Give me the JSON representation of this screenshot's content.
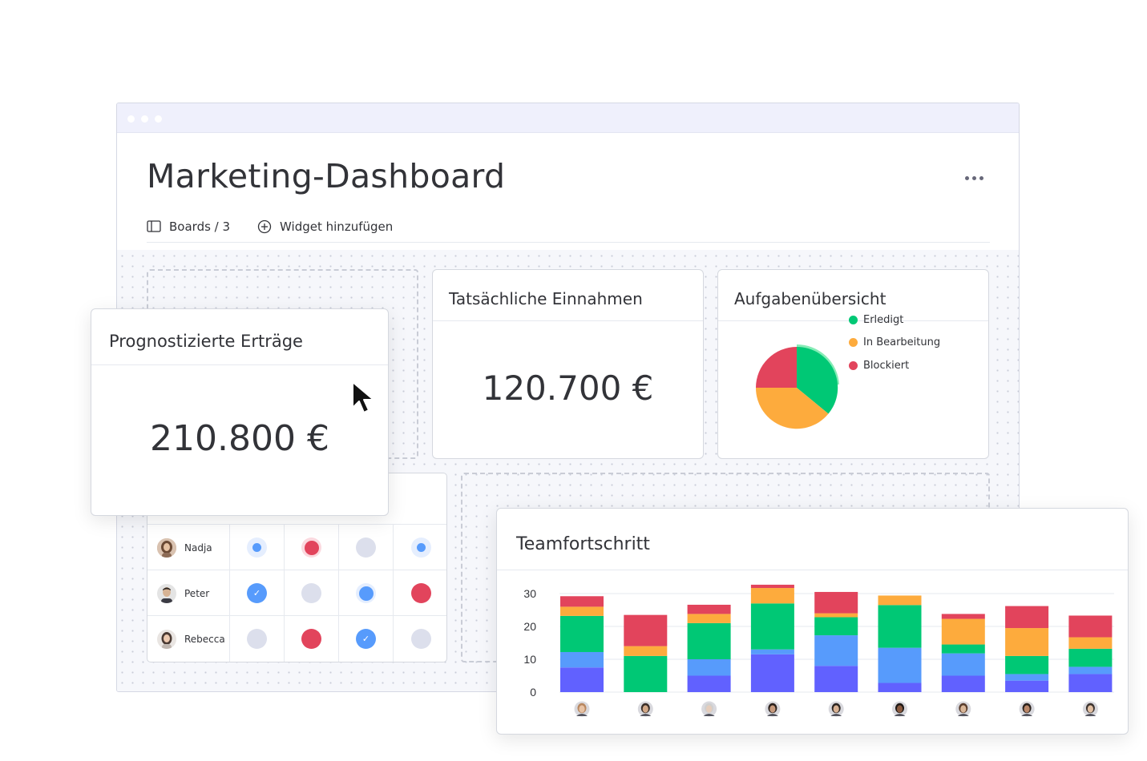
{
  "header": {
    "title": "Marketing-Dashboard",
    "boards_label": "Boards / 3",
    "add_widget_label": "Widget hinzufügen"
  },
  "widgets": {
    "forecast": {
      "title": "Prognostizierte Erträge",
      "value": "210.800 €"
    },
    "actual": {
      "title": "Tatsächliche Einnahmen",
      "value": "120.700 €"
    },
    "tasks": {
      "title": "Aufgabenübersicht",
      "legend": [
        {
          "label": "Erledigt",
          "color": "#00c875"
        },
        {
          "label": "In Bearbeitung",
          "color": "#fdab3d"
        },
        {
          "label": "Blockiert",
          "color": "#e2445c"
        }
      ]
    },
    "team": {
      "title": "Teamfortschritt"
    }
  },
  "people": [
    {
      "name": "Nadja",
      "statuses": [
        "blue-dot",
        "red-dot",
        "grey",
        "blue-dot"
      ]
    },
    {
      "name": "Peter",
      "statuses": [
        "blue-check",
        "grey",
        "blue-dot",
        "red"
      ]
    },
    {
      "name": "Rebecca",
      "statuses": [
        "grey",
        "red",
        "blue-check",
        "grey"
      ]
    }
  ],
  "colors": {
    "blue": "#579bfc",
    "red": "#e2445c",
    "grey": "#dcdfec",
    "green": "#00c875",
    "orange": "#fdab3d",
    "purple": "#6161ff"
  },
  "chart_data": {
    "type": "bar",
    "stacked": true,
    "ylim": [
      0,
      30
    ],
    "yticks": [
      "0",
      "10",
      "20",
      "30"
    ],
    "categories": [
      "",
      "",
      "",
      "",
      "",
      "",
      "",
      "",
      ""
    ],
    "series": [
      {
        "color": "#6161ff",
        "values": [
          7.5,
          0,
          5,
          11.5,
          8,
          2.8,
          5,
          3.5,
          5.5
        ]
      },
      {
        "color": "#579bfc",
        "values": [
          4.7,
          0,
          5,
          1.5,
          9.3,
          10.7,
          6.8,
          2,
          2.2
        ]
      },
      {
        "color": "#00c875",
        "values": [
          11,
          11,
          11,
          14,
          5.5,
          13,
          2.7,
          5.5,
          5.5
        ]
      },
      {
        "color": "#fdab3d",
        "values": [
          2.8,
          3,
          2.8,
          4.7,
          1.2,
          2.9,
          7.8,
          8.5,
          3.5
        ]
      },
      {
        "color": "#e2445c",
        "values": [
          3.2,
          9.5,
          2.8,
          1,
          6.5,
          0,
          1.5,
          6.7,
          6.6
        ]
      }
    ]
  }
}
